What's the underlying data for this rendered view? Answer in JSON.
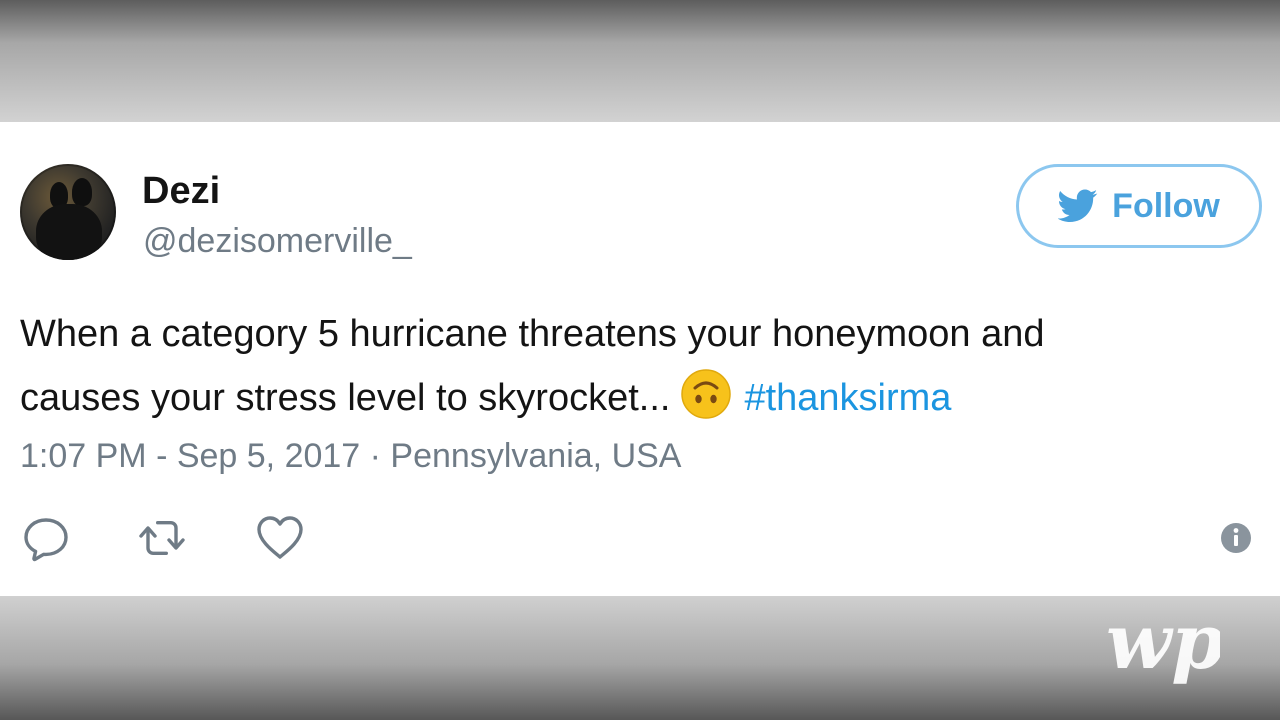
{
  "tweet": {
    "display_name": "Dezi",
    "handle": "@dezisomerville_",
    "follow_label": "Follow",
    "text_line1": "When a category 5 hurricane threatens your honeymoon and",
    "text_line2": "causes your stress level to skyrocket...",
    "hashtag": "#thanksirma",
    "timestamp_location": "1:07 PM - Sep 5, 2017 · Pennsylvania, USA",
    "emoji": "upside-down-face",
    "colors": {
      "accent": "#1b95e0",
      "follow_border": "#8cc7ef",
      "follow_text": "#4aa2dd",
      "meta_gray": "#6f7b86"
    }
  },
  "icons": {
    "reply": "reply-icon",
    "retweet": "retweet-icon",
    "like": "heart-icon",
    "info": "info-icon",
    "bird": "twitter-bird-icon"
  },
  "watermark": {
    "logo": "wp"
  }
}
